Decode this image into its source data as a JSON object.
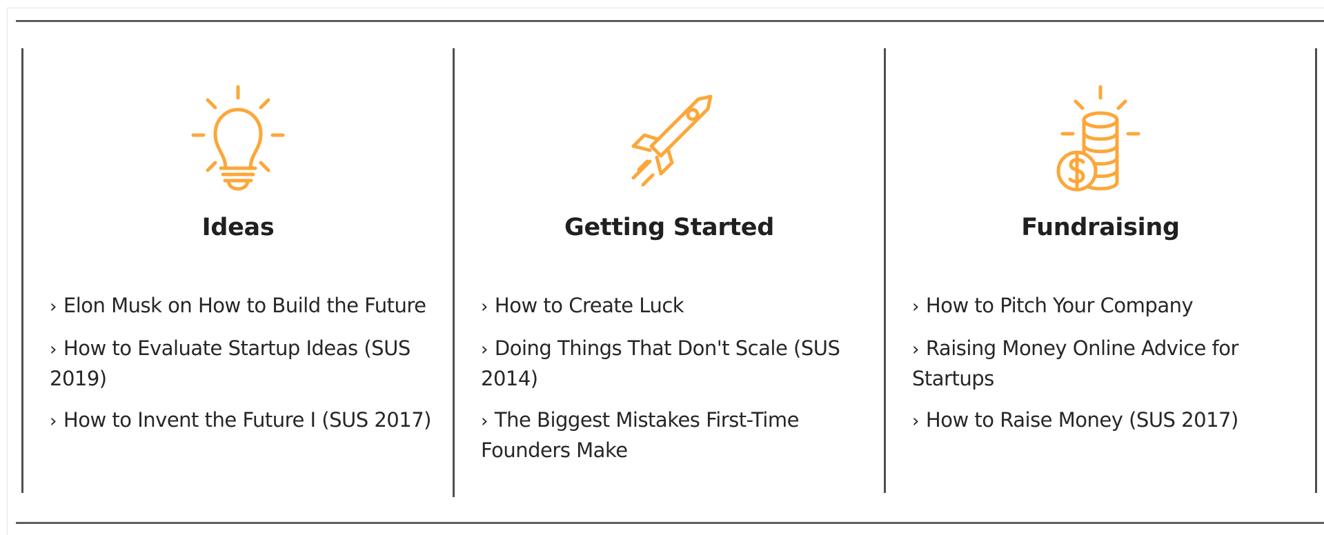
{
  "accent_color": "#fca739",
  "columns": [
    {
      "icon": "lightbulb-icon",
      "title": "Ideas",
      "links": [
        "Elon Musk on How to Build the Future",
        "How to Evaluate Startup Ideas (SUS 2019)",
        "How to Invent the Future I (SUS 2017)"
      ]
    },
    {
      "icon": "rocket-icon",
      "title": "Getting Started",
      "links": [
        "How to Create Luck",
        "Doing Things That Don't Scale (SUS 2014)",
        "The Biggest Mistakes First-Time Founders Make"
      ]
    },
    {
      "icon": "coins-dollar-icon",
      "title": "Fundraising",
      "links": [
        "How to Pitch Your Company",
        "Raising Money Online Advice for Startups",
        "How to Raise Money (SUS 2017)"
      ]
    }
  ],
  "link_prefix": "›"
}
